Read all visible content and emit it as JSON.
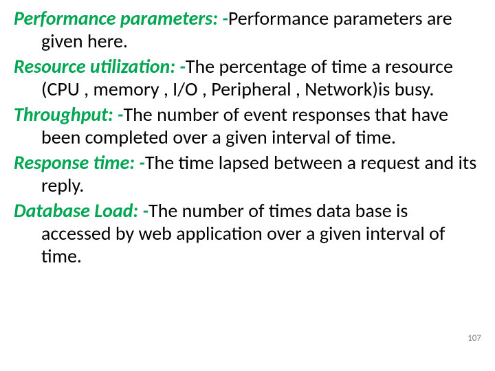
{
  "items": [
    {
      "term": "Performance parameters: -",
      "def": "Performance parameters are given here."
    },
    {
      "term": "Resource utilization: -",
      "def": "The percentage of time a resource (CPU , memory , I/O , Peripheral , Network)is busy."
    },
    {
      "term": "Throughput: -",
      "def": "The number of event responses that have been completed over a given interval of time."
    },
    {
      "term": "Response time: -",
      "def": "The time lapsed between a request and its reply."
    },
    {
      "term": "Database Load: -",
      "def": "The number of times data base is accessed by web application over a given interval of time."
    }
  ],
  "page_number": "107"
}
